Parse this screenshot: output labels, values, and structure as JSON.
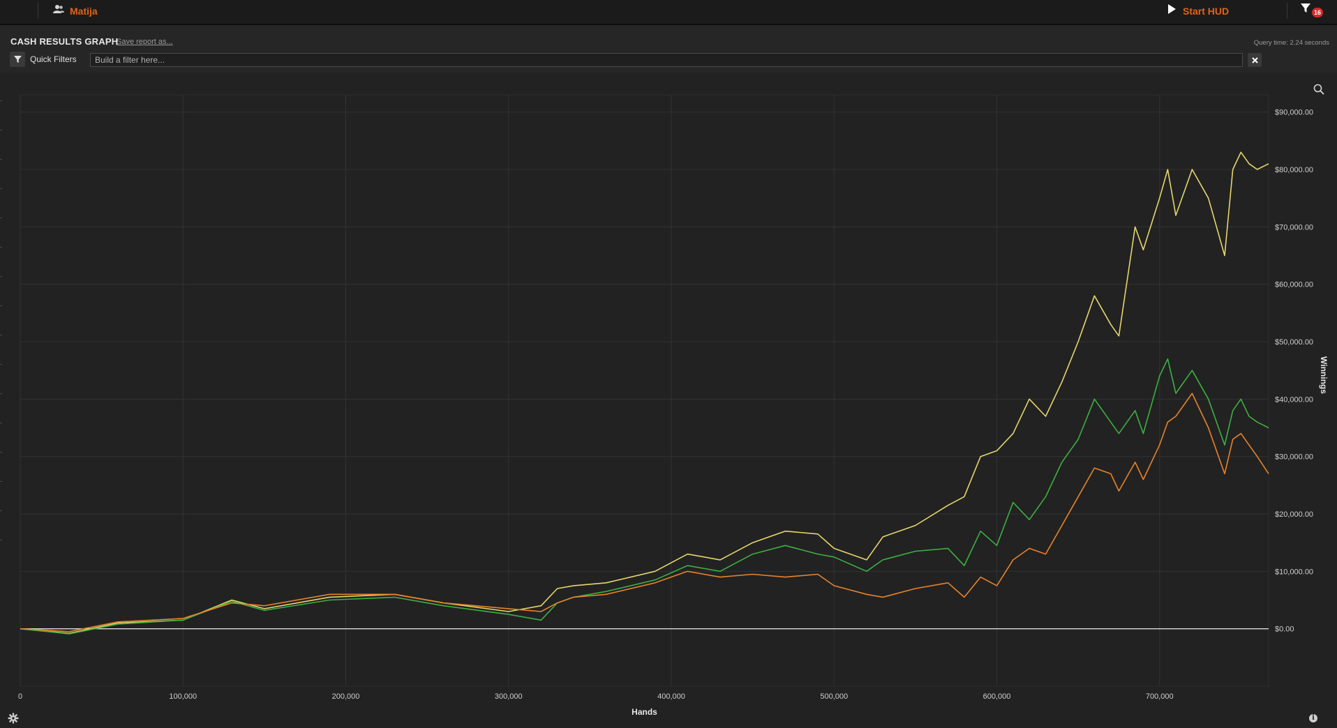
{
  "topbar": {
    "user_name": "Matija",
    "start_hud_label": "Start HUD",
    "filter_count": "16"
  },
  "report": {
    "title": "CASH RESULTS GRAPH",
    "save_link": "Save report as...",
    "query_time": "Query time: 2.24 seconds"
  },
  "quick_filters": {
    "label": "Quick Filters",
    "placeholder": "Build a filter here..."
  },
  "colors": {
    "yellow_series": "#e6d66b",
    "green_series": "#3cb043",
    "orange_series": "#e8832a",
    "accent": "#e0631a"
  },
  "icons": [
    "users-icon",
    "play-icon",
    "filter-icon",
    "close-icon",
    "zoom-icon",
    "gear-icon",
    "info-icon"
  ],
  "chart_data": {
    "type": "line",
    "xlabel": "Hands",
    "ylabel": "Winnings",
    "xlim": [
      0,
      767000
    ],
    "ylim": [
      -10000,
      93000
    ],
    "x_ticks": [
      0,
      100000,
      200000,
      300000,
      400000,
      500000,
      600000,
      700000
    ],
    "x_tick_labels": [
      "0",
      "100,000",
      "200,000",
      "300,000",
      "400,000",
      "500,000",
      "600,000",
      "700,000"
    ],
    "y_ticks": [
      0,
      10000,
      20000,
      30000,
      40000,
      50000,
      60000,
      70000,
      80000,
      90000
    ],
    "y_tick_labels": [
      "$0.00",
      "$10,000.00",
      "$20,000.00",
      "$30,000.00",
      "$40,000.00",
      "$50,000.00",
      "$60,000.00",
      "$70,000.00",
      "$80,000.00",
      "$90,000.00"
    ],
    "grid": true,
    "series": [
      {
        "color": "#e6d66b",
        "x": [
          0,
          30000,
          60000,
          100000,
          130000,
          150000,
          190000,
          230000,
          260000,
          300000,
          320000,
          330000,
          340000,
          360000,
          390000,
          410000,
          430000,
          450000,
          470000,
          490000,
          500000,
          520000,
          530000,
          550000,
          570000,
          580000,
          590000,
          600000,
          610000,
          620000,
          630000,
          640000,
          650000,
          660000,
          670000,
          675000,
          685000,
          690000,
          700000,
          705000,
          710000,
          720000,
          730000,
          740000,
          745000,
          750000,
          755000,
          760000,
          767000
        ],
        "y": [
          0,
          -800,
          1000,
          1500,
          5000,
          3500,
          5500,
          6000,
          4500,
          3000,
          4000,
          7000,
          7500,
          8000,
          10000,
          13000,
          12000,
          15000,
          17000,
          16500,
          14000,
          12000,
          16000,
          18000,
          21500,
          23000,
          30000,
          31000,
          34000,
          40000,
          37000,
          43000,
          50000,
          58000,
          53000,
          51000,
          70000,
          66000,
          75000,
          80000,
          72000,
          80000,
          75000,
          65000,
          80000,
          83000,
          81000,
          80000,
          81000
        ]
      },
      {
        "color": "#3cb043",
        "x": [
          0,
          30000,
          60000,
          100000,
          130000,
          150000,
          190000,
          230000,
          260000,
          300000,
          320000,
          330000,
          340000,
          360000,
          390000,
          410000,
          430000,
          450000,
          470000,
          490000,
          500000,
          520000,
          530000,
          550000,
          570000,
          580000,
          590000,
          600000,
          610000,
          620000,
          630000,
          640000,
          650000,
          660000,
          670000,
          675000,
          685000,
          690000,
          700000,
          705000,
          710000,
          720000,
          730000,
          740000,
          745000,
          750000,
          755000,
          760000,
          767000
        ],
        "y": [
          0,
          -900,
          800,
          1500,
          4800,
          3200,
          5000,
          5500,
          4000,
          2500,
          1500,
          4500,
          5500,
          6500,
          8500,
          11000,
          10000,
          13000,
          14500,
          13000,
          12500,
          10000,
          12000,
          13500,
          14000,
          11000,
          17000,
          14500,
          22000,
          19000,
          23000,
          29000,
          33000,
          40000,
          36000,
          34000,
          38000,
          34000,
          44000,
          47000,
          41000,
          45000,
          40000,
          32000,
          38000,
          40000,
          37000,
          36000,
          35000
        ]
      },
      {
        "color": "#e8832a",
        "x": [
          0,
          30000,
          60000,
          100000,
          130000,
          150000,
          190000,
          230000,
          260000,
          300000,
          320000,
          330000,
          340000,
          360000,
          390000,
          410000,
          430000,
          450000,
          470000,
          490000,
          500000,
          520000,
          530000,
          550000,
          570000,
          580000,
          590000,
          600000,
          610000,
          620000,
          630000,
          640000,
          650000,
          660000,
          670000,
          675000,
          685000,
          690000,
          700000,
          705000,
          710000,
          720000,
          730000,
          740000,
          745000,
          750000,
          755000,
          760000,
          767000
        ],
        "y": [
          0,
          -500,
          1200,
          1800,
          4500,
          4000,
          6000,
          6000,
          4500,
          3500,
          3000,
          4500,
          5500,
          6000,
          8000,
          10000,
          9000,
          9500,
          9000,
          9500,
          7500,
          6000,
          5500,
          7000,
          8000,
          5500,
          9000,
          7500,
          12000,
          14000,
          13000,
          18000,
          23000,
          28000,
          27000,
          24000,
          29000,
          26000,
          32000,
          36000,
          37000,
          41000,
          35000,
          27000,
          33000,
          34000,
          32000,
          30000,
          27000
        ]
      }
    ]
  }
}
